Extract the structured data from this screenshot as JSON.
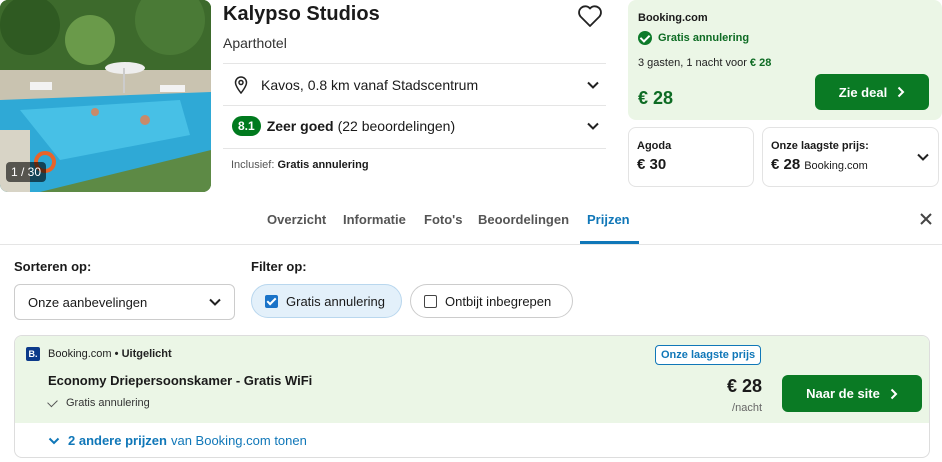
{
  "photo": {
    "counter": "1 / 30"
  },
  "hotel": {
    "name": "Kalypso Studios",
    "type": "Aparthotel",
    "location": "Kavos, 0.8 km vanaf Stadscentrum",
    "rating_score": "8.1",
    "rating_label": "Zeer goed",
    "rating_count": "(22 beoordelingen)",
    "included_prefix": "Inclusief:",
    "included_value": "Gratis annulering"
  },
  "deal": {
    "site": "Booking.com",
    "cancel": "Gratis annulering",
    "guests_prefix": "3 gasten, 1 nacht voor",
    "guests_price": "€ 28",
    "price": "€ 28",
    "button": "Zie deal"
  },
  "agoda": {
    "site": "Agoda",
    "price": "€ 30"
  },
  "lowest": {
    "label": "Onze laagste prijs:",
    "price": "€ 28",
    "site": "Booking.com"
  },
  "tabs": [
    {
      "label": "Overzicht"
    },
    {
      "label": "Informatie"
    },
    {
      "label": "Foto's"
    },
    {
      "label": "Beoordelingen"
    },
    {
      "label": "Prijzen",
      "active": true
    }
  ],
  "sort": {
    "label": "Sorteren op:",
    "value": "Onze aanbevelingen"
  },
  "filter": {
    "label": "Filter op:",
    "options": [
      {
        "label": "Gratis annulering",
        "checked": true
      },
      {
        "label": "Ontbijt inbegrepen",
        "checked": false
      }
    ]
  },
  "offer": {
    "site": "Booking.com",
    "tag": "• Uitgelicht",
    "badge": "Onze laagste prijs",
    "room": "Economy Driepersoonskamer - Gratis WiFi",
    "cancel": "Gratis annulering",
    "price": "€ 28",
    "per": "/nacht",
    "button": "Naar de site",
    "more_bold": "2 andere prijzen",
    "more_rest": "van Booking.com tonen"
  },
  "colors": {
    "green": "#0a7a24",
    "deal_bg": "#ebf6e6",
    "link": "#1077b8",
    "rating": "#007a1e"
  },
  "icons": [
    "heart-icon",
    "location-pin-icon",
    "chevron-down-icon",
    "check-circle-icon",
    "chevron-right-icon",
    "close-icon",
    "checkbox-icon",
    "checkmark-icon"
  ]
}
